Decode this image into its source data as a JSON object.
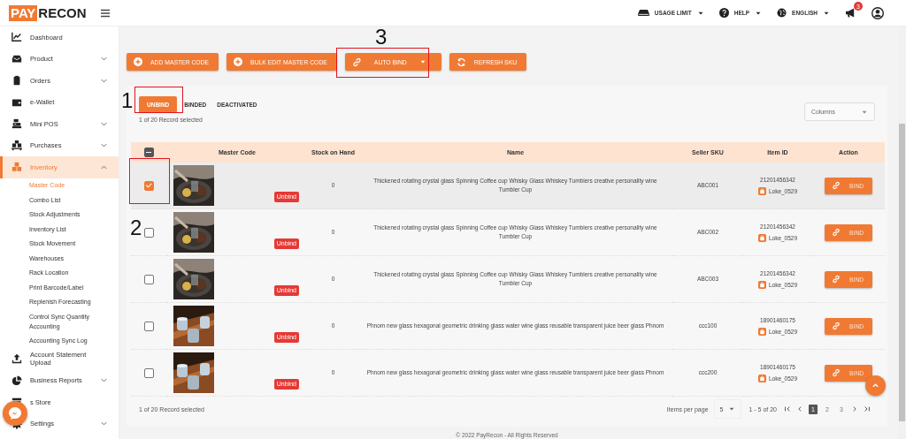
{
  "topbar": {
    "logo": {
      "part_1": "PAY",
      "part_2": "RECON"
    },
    "menus": [
      {
        "label": "USAGE LIMIT"
      },
      {
        "label": "HELP"
      },
      {
        "label": "ENGLISH"
      }
    ],
    "notifications": {
      "count": "3"
    }
  },
  "sidebar": {
    "items": [
      {
        "label": "Dashboard",
        "selected": false
      },
      {
        "label": "Product",
        "selected": false,
        "expanded": false
      },
      {
        "label": "Orders",
        "selected": false,
        "expanded": false
      },
      {
        "label": "e-Wallet",
        "selected": false
      },
      {
        "label": "Mini POS",
        "selected": false,
        "expanded": false
      },
      {
        "label": "Purchases",
        "selected": false,
        "expanded": false
      },
      {
        "label": "Inventory",
        "selected": true,
        "expanded": true,
        "children": [
          {
            "label": "Master Code",
            "selected": true
          },
          {
            "label": "Combo List",
            "selected": false
          },
          {
            "label": "Stock Adjustments",
            "selected": false
          },
          {
            "label": "Inventory List",
            "selected": false
          },
          {
            "label": "Stock Movement",
            "selected": false
          },
          {
            "label": "Warehouses",
            "selected": false
          },
          {
            "label": "Rack Location",
            "selected": false
          },
          {
            "label": "Print Barcode/Label",
            "selected": false
          },
          {
            "label": "Replenish Forecasting",
            "selected": false
          },
          {
            "label": "Control Sync Quantity Accounting",
            "selected": false
          },
          {
            "label": "Accounting Sync Log",
            "selected": false
          }
        ]
      },
      {
        "label": "Account Statement Upload",
        "selected": false
      },
      {
        "label": "Business Reports",
        "selected": false,
        "expanded": false
      },
      {
        "label": "s Store",
        "selected": false
      },
      {
        "label": "Settings",
        "selected": false,
        "expanded": false
      }
    ]
  },
  "toolbar": {
    "buttons": [
      {
        "label": "ADD MASTER CODE",
        "dropdown": false
      },
      {
        "label": "BULK EDIT MASTER CODE",
        "dropdown": false
      },
      {
        "label": "AUTO BIND",
        "dropdown": true
      },
      {
        "label": "REFRESH SKU",
        "dropdown": false
      }
    ]
  },
  "tabs": [
    {
      "label": "UNBIND",
      "selected": true
    },
    {
      "label": "BINDED",
      "selected": false
    },
    {
      "label": "DEACTIVATED",
      "selected": false
    }
  ],
  "selection_summary": "1 of 20 Record selected",
  "columns_select": {
    "placeholder": "Columns"
  },
  "table": {
    "header_checkbox": {
      "indeterminate": true
    },
    "columns": [
      "Master Code",
      "Stock on Hand",
      "Name",
      "Seller SKU",
      "Item ID",
      "Action"
    ],
    "rows": [
      {
        "selected": true,
        "status": "Unbind",
        "stock": "0",
        "name": "Thickened rotating crystal glass Spinning Coffee cup Whisky Glass Whiskey Tumblers creative personality wine Tumbler Cup",
        "seller_sku": "ABC001",
        "item_id": "21201456342",
        "shop": "Loke_0529",
        "action": "BIND"
      },
      {
        "selected": false,
        "status": "Unbind",
        "stock": "0",
        "name": "Thickened rotating crystal glass Spinning Coffee cup Whisky Glass Whiskey Tumblers creative personality wine Tumbler Cup",
        "seller_sku": "ABC002",
        "item_id": "21201456342",
        "shop": "Loke_0529",
        "action": "BIND"
      },
      {
        "selected": false,
        "status": "Unbind",
        "stock": "0",
        "name": "Thickened rotating crystal glass Spinning Coffee cup Whisky Glass Whiskey Tumblers creative personality wine Tumbler Cup",
        "seller_sku": "ABC003",
        "item_id": "21201456342",
        "shop": "Loke_0529",
        "action": "BIND"
      },
      {
        "selected": false,
        "status": "Unbind",
        "stock": "0",
        "name": "Phnom new glass hexagonal geometric drinking glass water wine glass reusable transparent juice beer glass Phnom",
        "seller_sku": "ccc100",
        "item_id": "18901460175",
        "shop": "Loke_0529",
        "action": "BIND"
      },
      {
        "selected": false,
        "status": "Unbind",
        "stock": "0",
        "name": "Phnom new glass hexagonal geometric drinking glass water wine glass reusable transparent juice beer glass Phnom",
        "seller_sku": "ccc200",
        "item_id": "18901460175",
        "shop": "Loke_0529",
        "action": "BIND"
      }
    ]
  },
  "footer_summary": "1 of 20 Record selected",
  "pagination": {
    "items_per_page_label": "Items per page",
    "page_size": "5",
    "range": "1 - 5 of 20",
    "pages": [
      {
        "label": "1",
        "selected": true
      },
      {
        "label": "2",
        "selected": false
      },
      {
        "label": "3",
        "selected": false
      }
    ]
  },
  "copyright": "© 2022 PayRecon - All Rights Reserved",
  "annotations": [
    {
      "label": "1"
    },
    {
      "label": "2"
    },
    {
      "label": "3"
    }
  ]
}
